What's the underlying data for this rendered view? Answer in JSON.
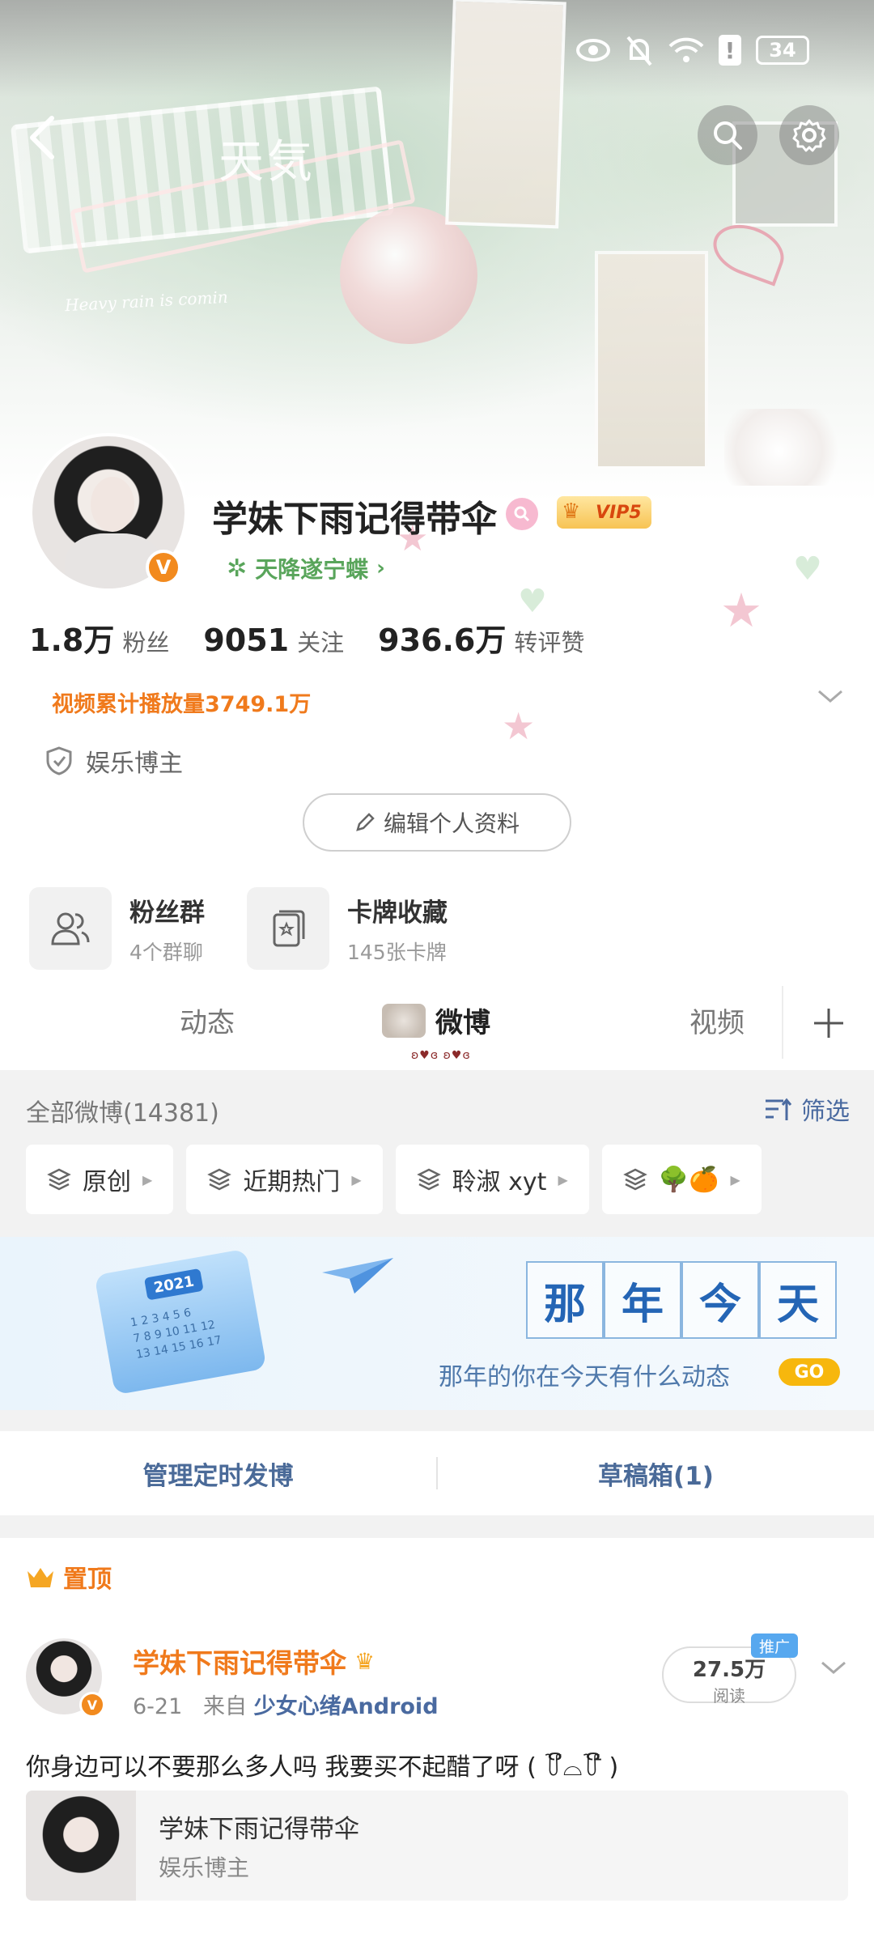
{
  "status_bar": {
    "battery": "34"
  },
  "banner": {
    "art_title": "天気",
    "art_script": "Heavy rain is comin"
  },
  "profile": {
    "name": "学妹下雨记得带伞",
    "vip": "VIP5",
    "group": "天降遂宁蝶",
    "stats": [
      {
        "num": "1.8万",
        "label": "粉丝"
      },
      {
        "num": "9051",
        "label": "关注"
      },
      {
        "num": "936.6万",
        "label": "转评赞"
      }
    ],
    "play_count": "视频累计播放量3749.1万",
    "role": "娱乐博主",
    "edit_label": "编辑个人资料"
  },
  "tiles": [
    {
      "title": "粉丝群",
      "sub": "4个群聊",
      "icon": "people-icon"
    },
    {
      "title": "卡牌收藏",
      "sub": "145张卡牌",
      "icon": "card-icon"
    }
  ],
  "tabs": {
    "items": [
      "动态",
      "微博",
      "视频"
    ],
    "active": "微博",
    "tab_deco_text": "ʚ♥ɞ ʚ♥ɞ"
  },
  "feed": {
    "header": "全部微博(14381)",
    "filter_label": "筛选",
    "chips": [
      "原创",
      "近期热门",
      "聆淑 xyt",
      "🌳🍊"
    ],
    "memory": {
      "chars": [
        "那",
        "年",
        "今",
        "天"
      ],
      "subtitle": "那年的你在今天有什么动态",
      "go": "GO",
      "cal_year": "2021",
      "cal_grid": "1 2 3 4 5 6\n7 8 9 10 11 12\n13 14 15 16 17"
    },
    "manage": {
      "scheduled": "管理定时发博",
      "drafts": "草稿箱(1)"
    }
  },
  "post": {
    "pinned": "置顶",
    "author": "学妹下雨记得带伞",
    "date": "6-21",
    "from_prefix": "来自",
    "source": "少女心绪Android",
    "reads_num": "27.5万",
    "reads_label": "阅读",
    "promo": "推广",
    "text": "你身边可以不要那么多人吗 我要买不起醋了呀 (  ꒦ິ⌓꒦ີ  )",
    "share_title": "学妹下雨记得带伞",
    "share_sub": "娱乐博主"
  }
}
